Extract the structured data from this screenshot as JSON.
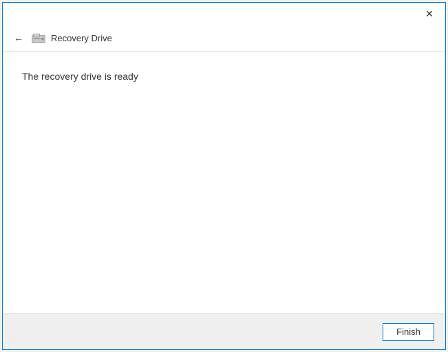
{
  "window": {
    "title": "Recovery Drive"
  },
  "header": {
    "title": "Recovery Drive",
    "drive_icon": "drive-icon"
  },
  "content": {
    "message": "The recovery drive is ready"
  },
  "footer": {
    "finish_label": "Finish"
  },
  "icons": {
    "close": "✕",
    "back": "←"
  }
}
